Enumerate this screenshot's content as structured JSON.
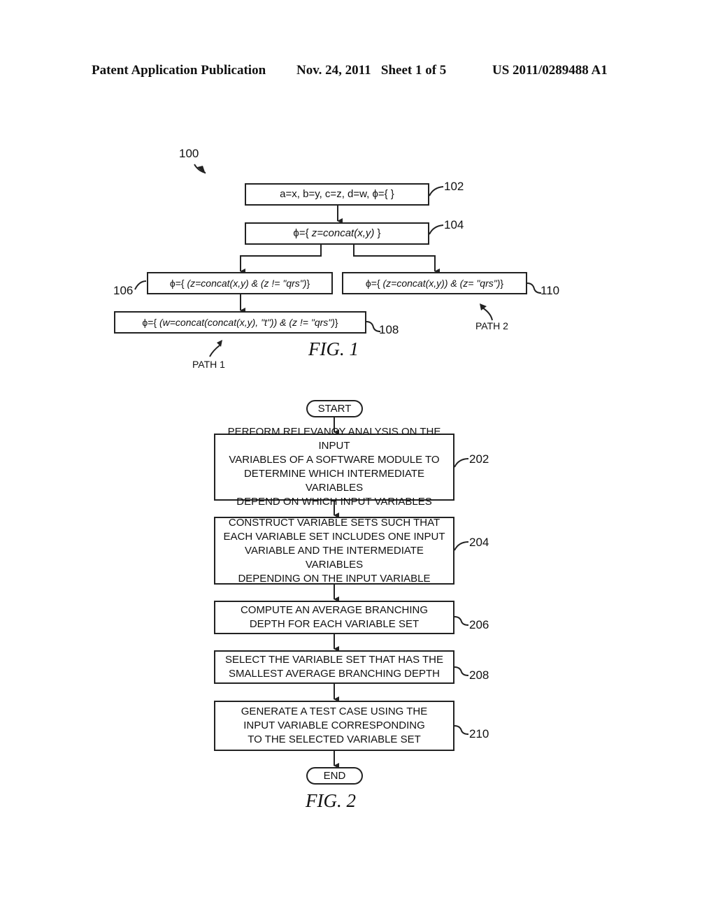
{
  "header": {
    "publication": "Patent Application Publication",
    "date_sheet": "Nov. 24, 2011   Sheet 1 of 5",
    "number": "US 2011/0289488 A1"
  },
  "fig1": {
    "ref_main": "100",
    "caption": "FIG. 1",
    "boxes": [
      {
        "ref": "102",
        "text": "a=x, b=y, c=z, d=w, ϕ={ }"
      },
      {
        "ref": "104",
        "prefix": "ϕ={ ",
        "italic": "z=concat(x,y)",
        "suffix": " }"
      },
      {
        "ref": "106",
        "prefix": "ϕ={ ",
        "italic": "(z=concat(x,y) & (z != \"qrs\")",
        "suffix": "}"
      },
      {
        "ref": "108",
        "prefix": "ϕ={ ",
        "italic": "(w=concat(concat(x,y), \"t\")) & (z != \"qrs\")",
        "suffix": "}"
      },
      {
        "ref": "110",
        "prefix": "ϕ={ ",
        "italic": "(z=concat(x,y)) & (z= \"qrs\")",
        "suffix": "}"
      }
    ],
    "path1": "PATH 1",
    "path2": "PATH 2"
  },
  "fig2": {
    "caption": "FIG. 2",
    "start": "START",
    "end": "END",
    "steps": [
      {
        "ref": "202",
        "lines": [
          "PERFORM RELEVANCY ANALYSIS ON THE INPUT",
          "VARIABLES OF A SOFTWARE MODULE TO",
          "DETERMINE WHICH INTERMEDIATE VARIABLES",
          "DEPEND ON WHICH INPUT VARIABLES"
        ]
      },
      {
        "ref": "204",
        "lines": [
          "CONSTRUCT VARIABLE SETS SUCH THAT",
          "EACH VARIABLE SET INCLUDES ONE INPUT",
          "VARIABLE AND THE INTERMEDIATE VARIABLES",
          "DEPENDING ON THE INPUT VARIABLE"
        ]
      },
      {
        "ref": "206",
        "lines": [
          "COMPUTE AN AVERAGE BRANCHING",
          "DEPTH FOR EACH VARIABLE SET"
        ]
      },
      {
        "ref": "208",
        "lines": [
          "SELECT THE VARIABLE SET THAT HAS THE",
          "SMALLEST AVERAGE BRANCHING DEPTH"
        ]
      },
      {
        "ref": "210",
        "lines": [
          "GENERATE A TEST CASE USING THE",
          "INPUT VARIABLE CORRESPONDING",
          "TO THE SELECTED VARIABLE SET"
        ]
      }
    ]
  }
}
